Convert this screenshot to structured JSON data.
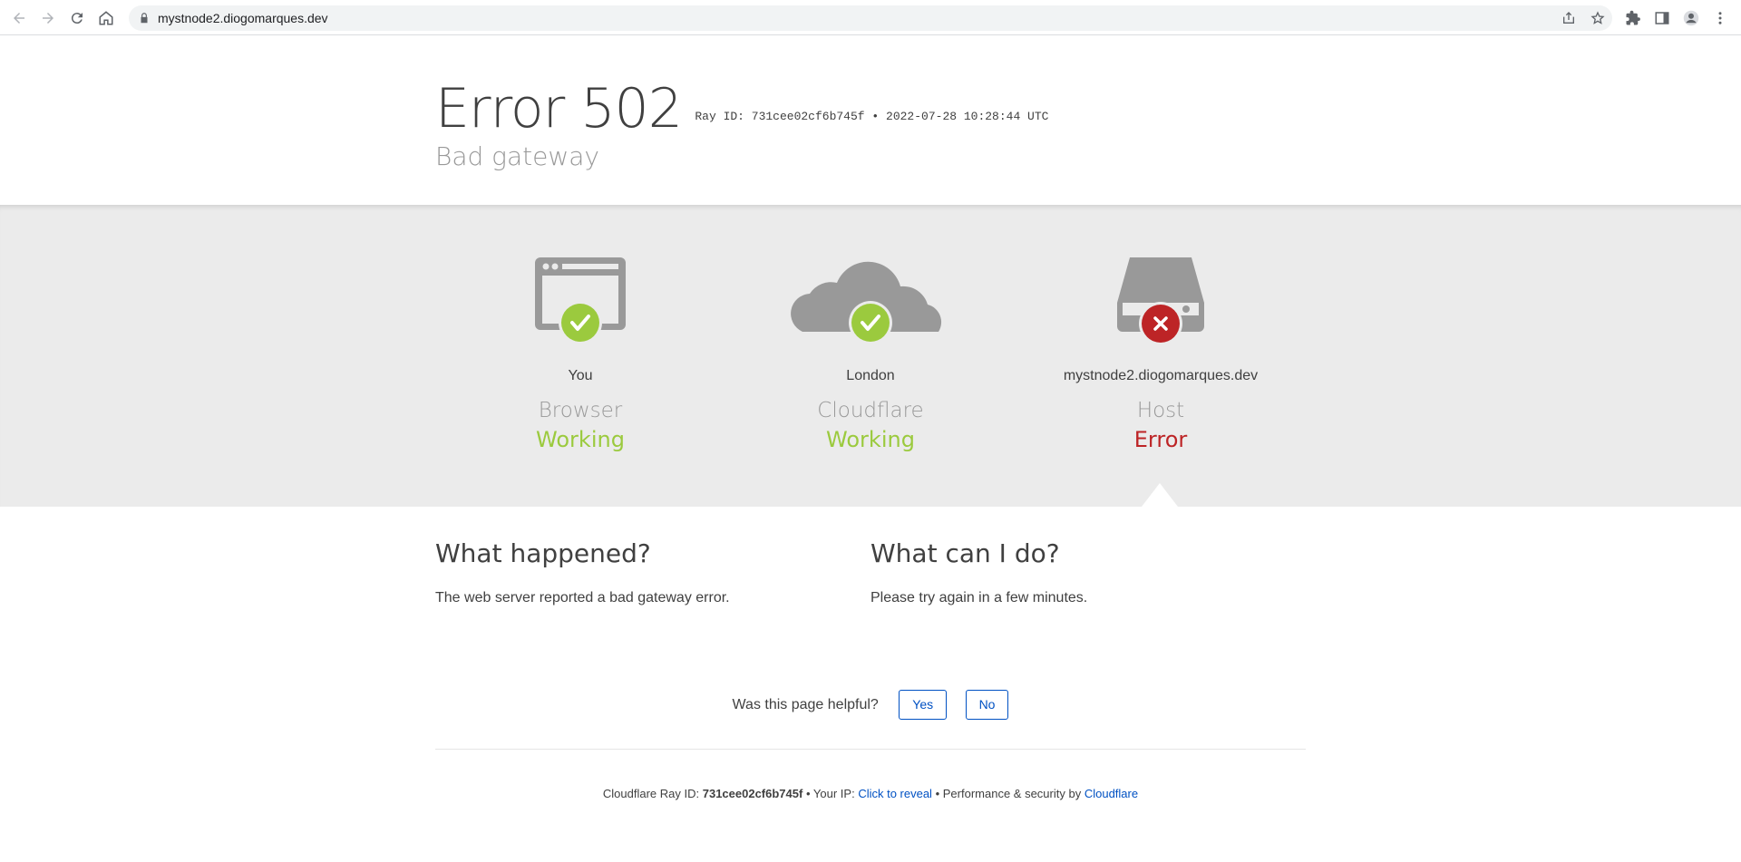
{
  "browser": {
    "url": "mystnode2.diogomarques.dev",
    "icons": [
      "back-icon",
      "forward-icon",
      "reload-icon",
      "home-icon",
      "lock-icon",
      "share-icon",
      "star-icon",
      "extensions-icon",
      "side-panel-icon",
      "profile-icon",
      "menu-icon"
    ]
  },
  "header": {
    "error_title": "Error 502",
    "ray_id_label": "Ray ID: 731cee02cf6b745f",
    "ray_separator": "•",
    "timestamp": "2022-07-28 10:28:44 UTC",
    "subtitle": "Bad gateway"
  },
  "status": {
    "columns": [
      {
        "location": "You",
        "role": "Browser",
        "state": "Working",
        "state_type": "ok",
        "icon": "browser-icon"
      },
      {
        "location": "London",
        "role": "Cloudflare",
        "state": "Working",
        "state_type": "ok",
        "icon": "cloud-icon"
      },
      {
        "location": "mystnode2.diogomarques.dev",
        "role": "Host",
        "state": "Error",
        "state_type": "error",
        "icon": "server-icon"
      }
    ]
  },
  "sections": {
    "what_happened": {
      "title": "What happened?",
      "body": "The web server reported a bad gateway error."
    },
    "what_can_i_do": {
      "title": "What can I do?",
      "body": "Please try again in a few minutes."
    }
  },
  "feedback": {
    "question": "Was this page helpful?",
    "yes": "Yes",
    "no": "No"
  },
  "footer": {
    "ray_label": "Cloudflare Ray ID:",
    "ray_id": "731cee02cf6b745f",
    "sep1": "•",
    "ip_label": "Your IP:",
    "ip_link": "Click to reveal",
    "sep2": "•",
    "perf_label": "Performance & security by",
    "perf_link": "Cloudflare"
  },
  "colors": {
    "ok": "#9bca3e",
    "error": "#bd2426",
    "icon_gray": "#999999",
    "link": "#0051c3",
    "status_bg": "#ebebeb"
  }
}
